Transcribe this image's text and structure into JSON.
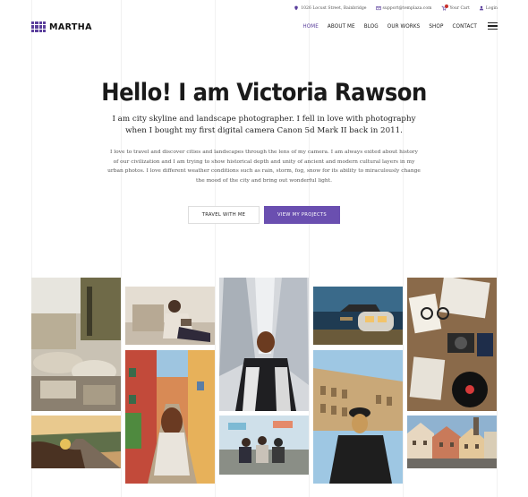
{
  "topbar": {
    "address": "1026 Locust Street, Bainbridge",
    "email": "support@templaza.com",
    "cart": "Your Cart",
    "login": "Login"
  },
  "brand": {
    "name": "MARTHA",
    "accent": "#5b3f9c"
  },
  "nav": {
    "items": [
      {
        "label": "HOME",
        "active": true
      },
      {
        "label": "ABOUT ME"
      },
      {
        "label": "BLOG"
      },
      {
        "label": "OUR WORKS"
      },
      {
        "label": "SHOP"
      },
      {
        "label": "CONTACT"
      }
    ]
  },
  "hero": {
    "title": "Hello! I am Victoria Rawson",
    "lead": "I am city skyline and landscape photographer. I fell in love with photography when I bought my first digital camera Canon 5d Mark II back in 2011.",
    "body": "I love to travel and discover cities and landscapes through the lens of my camera. I am always exited about history of our civilization and I am trying to show historical depth and unity of ancient and modern cultural layers in my urban photos. I love different weather conditions such as rain, storm, fog, snow for its ability to miraculously change the mood of the city and bring out wonderful light.",
    "buttons": {
      "travel": "TRAVEL WITH ME",
      "projects": "VIEW MY PROJECTS"
    }
  },
  "gallery": {
    "photos": [
      "market-stall-photo",
      "road-trip-photo",
      "woman-reading-photo",
      "colorful-street-photo",
      "city-towers-photo",
      "friends-group-photo",
      "camper-van-photo",
      "colosseum-photo",
      "flatlay-camera-photo",
      "old-town-photo"
    ]
  }
}
